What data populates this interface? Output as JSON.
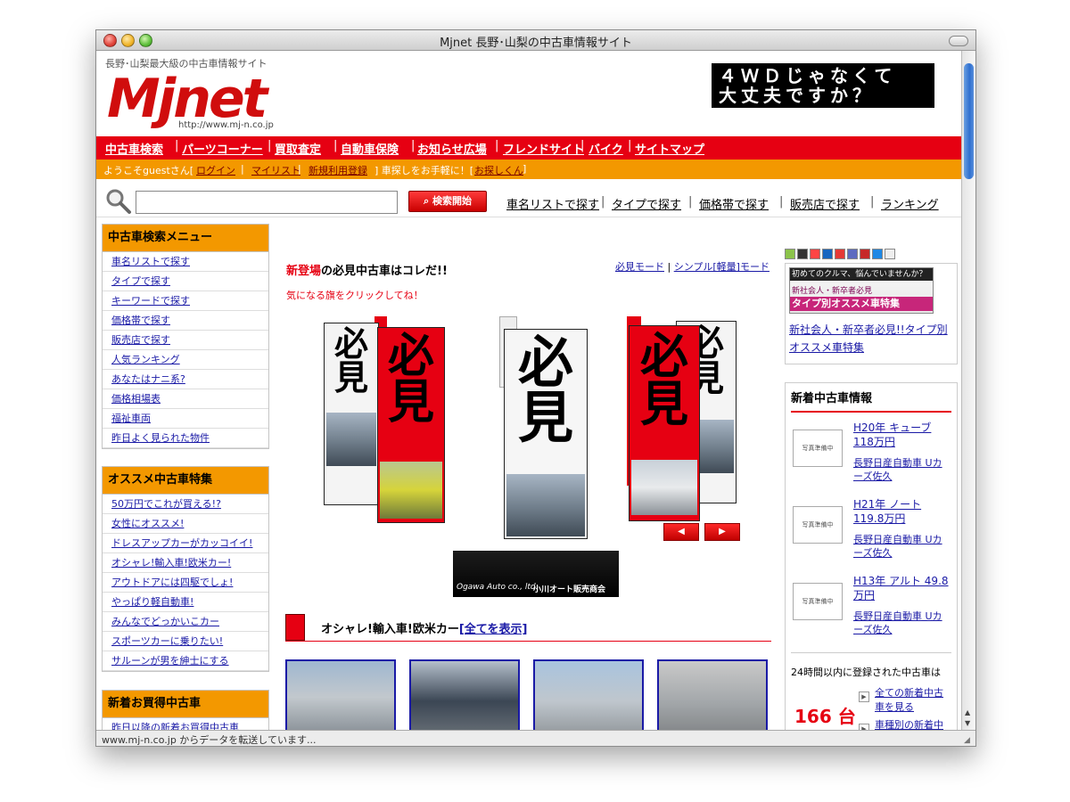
{
  "window": {
    "title": "Mjnet 長野･山梨の中古車情報サイト",
    "status": "www.mj-n.co.jp からデータを転送しています..."
  },
  "header": {
    "tagline": "長野･山梨最大級の中古車情報サイト",
    "logo": "Mjnet",
    "logo_url": "http://www.mj-n.co.jp",
    "banner_line1": "４ＷＤじゃなくて",
    "banner_line2": "大丈夫ですか？"
  },
  "nav": {
    "items": [
      "中古車検索",
      "パーツコーナー",
      "買取査定",
      "自動車保険",
      "お知らせ広場",
      "フレンドサイト",
      "バイク",
      "サイトマップ"
    ]
  },
  "userbar": {
    "welcome": "ようこそguestさん[",
    "login": "ログイン",
    "mylist": "マイリスト",
    "register": "新規利用登録",
    "middle": "] 車探しをお手軽に！[",
    "helper": "お探しくん",
    "end": "]"
  },
  "search": {
    "placeholder": "",
    "button": "検索開始",
    "links": [
      "車名リストで探す",
      "タイプで探す",
      "価格帯で探す",
      "販売店で探す",
      "ランキング"
    ]
  },
  "menu1": {
    "title": "中古車検索メニュー",
    "items": [
      "車名リストで探す",
      "タイプで探す",
      "キーワードで探す",
      "価格帯で探す",
      "販売店で探す",
      "人気ランキング",
      "あなたはナニ系?",
      "価格相場表",
      "福祉車両",
      "昨日よく見られた物件"
    ]
  },
  "menu2": {
    "title": "オススメ中古車特集",
    "items": [
      "50万円でこれが買える!?",
      "女性にオススメ!",
      "ドレスアップカーがカッコイイ!",
      "オシャレ!輸入車!欧米カー!",
      "アウトドアには四駆でしょ!",
      "やっぱり軽自動車!",
      "みんなでどっかいこカー",
      "スポーツカーに乗りたい!",
      "サルーンが男を紳士にする"
    ]
  },
  "menu3": {
    "title": "新着お買得中古車",
    "items": [
      "昨日以降の新着お買得中古車"
    ]
  },
  "featured": {
    "title_red": "新登場",
    "title_rest": "の必見中古車はコレだ!!",
    "subtitle": "気になる旗をクリックしてね！",
    "mode1": "必見モード",
    "mode2": "シンプル[軽量]モード",
    "flag_text1": "必",
    "flag_text2": "見",
    "prev": "◀",
    "next": "▶",
    "shop_logo": "Ogawa Auto co., ltd.",
    "shop_name": "小川オート販売商会"
  },
  "section": {
    "title": "オシャレ!輸入車!欧米カー",
    "link": "[全てを表示]"
  },
  "right": {
    "promo": {
      "line1": "初めてのクルマ、悩んでいませんか？",
      "line2": "新社会人・新卒者必見",
      "line3": "タイプ別オススメ車特集",
      "link": "新社会人・新卒者必見!!タイプ別オススメ車特集"
    },
    "news_title": "新着中古車情報",
    "news": [
      {
        "photo": "写真準備中",
        "title": "H20年 キューブ 118万円",
        "shop": "長野日産自動車 Uカーズ佐久"
      },
      {
        "photo": "写真準備中",
        "title": "H21年 ノート 119.8万円",
        "shop": "長野日産自動車 Uカーズ佐久"
      },
      {
        "photo": "写真準備中",
        "title": "H13年 アルト 49.8万円",
        "shop": "長野日産自動車 Uカーズ佐久"
      }
    ],
    "count_label": "24時間以内に登録された中古車は",
    "count": "166 台",
    "link_all": "全ての新着中古車を見る",
    "link_type": "車種別の新着中"
  },
  "colors": {
    "brand_red": "#e60012",
    "orange": "#f39800",
    "link": "#1a1aa6"
  }
}
